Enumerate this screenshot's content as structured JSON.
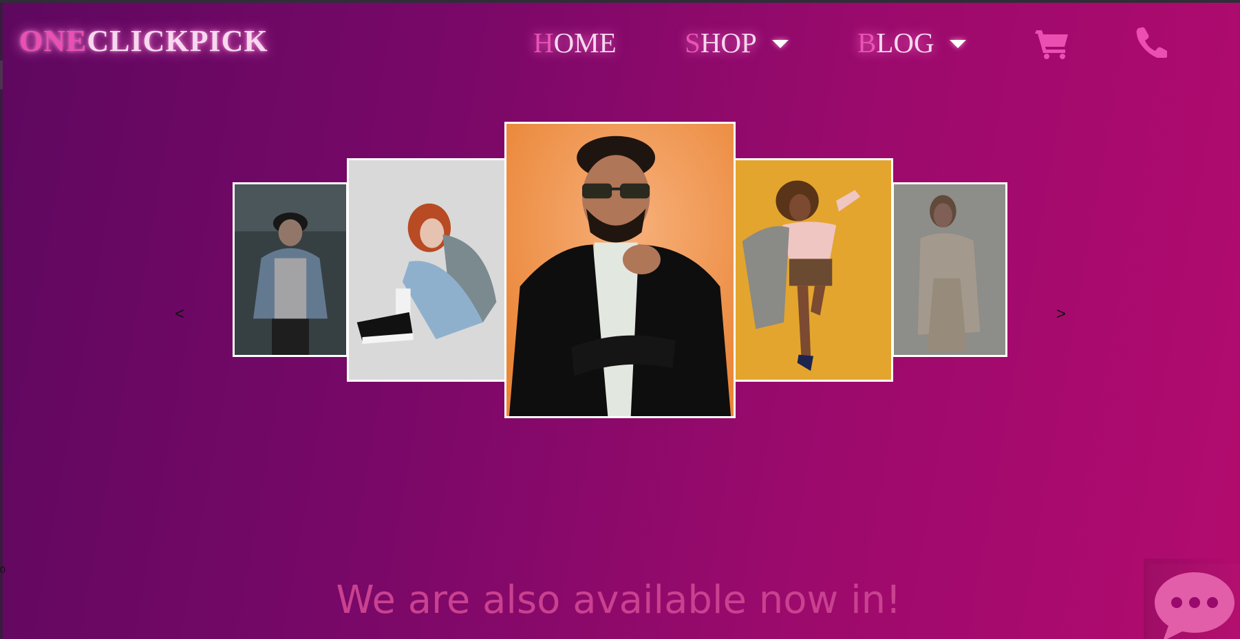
{
  "brand": {
    "part1": "ONE",
    "part2": "CLICKPICK"
  },
  "nav": {
    "home": {
      "first": "H",
      "rest": "OME"
    },
    "shop": {
      "first": "S",
      "rest": "HOP"
    },
    "blog": {
      "first": "B",
      "rest": "LOG"
    },
    "cart_icon": "cart-icon",
    "phone_icon": "phone-icon"
  },
  "carousel": {
    "prev_label": "<",
    "next_label": ">",
    "slides": [
      {
        "name": "man-in-cap-denim-jacket",
        "active": false
      },
      {
        "name": "woman-red-hair-sitting",
        "active": false
      },
      {
        "name": "man-sunglasses-black-blazer",
        "active": true
      },
      {
        "name": "woman-curly-hair-kicking",
        "active": false
      },
      {
        "name": "woman-beige-coat",
        "active": false
      }
    ]
  },
  "section": {
    "headline": "We are also available now in!"
  },
  "edge_text": "0",
  "colors": {
    "accent_pink": "#ec4fb2",
    "nav_text": "#f6d8ee",
    "headline": "#c9418f",
    "background_start": "#5e0860",
    "background_end": "#b30b6e"
  }
}
